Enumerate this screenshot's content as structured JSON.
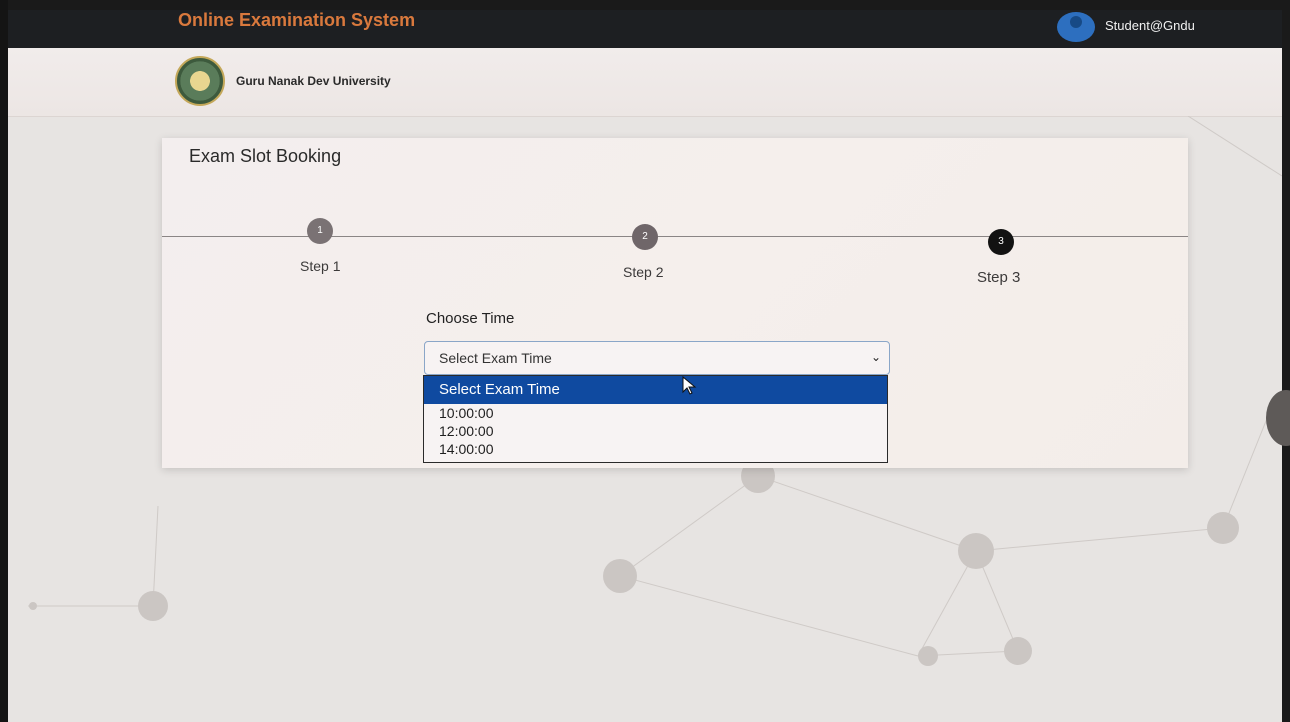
{
  "app": {
    "brand_title": "Online Examination System",
    "user_label": "Student@Gndu",
    "university_name": "Guru Nanak Dev University"
  },
  "page": {
    "title": "Exam Slot Booking"
  },
  "stepper": {
    "steps": [
      {
        "number": "1",
        "label": "Step 1"
      },
      {
        "number": "2",
        "label": "Step 2"
      },
      {
        "number": "3",
        "label": "Step 3"
      }
    ],
    "active_step": "3"
  },
  "form": {
    "label": "Choose Time",
    "selected_value": "Select Exam Time",
    "options": [
      "Select Exam Time",
      "10:00:00",
      "12:00:00",
      "14:00:00"
    ]
  },
  "colors": {
    "brand": "#d9793d",
    "topbar": "#1d1f22",
    "selected_option": "#0f4aa0",
    "active_step": "#121212"
  }
}
